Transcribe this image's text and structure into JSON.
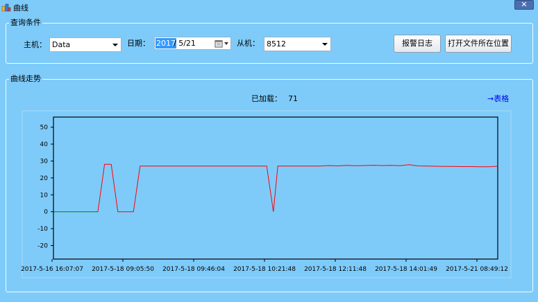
{
  "window": {
    "title": "曲线",
    "close_label": "✕"
  },
  "query": {
    "group_title": "查询条件",
    "host_label": "主机：",
    "host_value": "Data",
    "date_label": "日期：",
    "date_year": "2017",
    "date_rest": "/  5/21",
    "slave_label": "从机：",
    "slave_value": "8512",
    "alarm_log_button": "报警日志",
    "open_folder_button": "打开文件所在位置"
  },
  "trend": {
    "group_title": "曲线走势",
    "loaded_label": "已加载：",
    "loaded_count": "71",
    "table_link": "→表格"
  },
  "icons": {
    "app": "chart-window-icon",
    "calendar": "calendar-icon",
    "dropdown": "chevron-down-icon"
  },
  "chart_data": {
    "type": "line",
    "title": "",
    "xlabel": "",
    "ylabel": "",
    "ylim": [
      -28,
      56
    ],
    "yticks": [
      -20,
      -10,
      0,
      10,
      20,
      30,
      40,
      50
    ],
    "xtick_labels": [
      "2017-5-16 16:07:07",
      "2017-5-18 09:05:50",
      "2017-5-18 09:46:04",
      "2017-5-18 10:21:48",
      "2017-5-18 12:11:48",
      "2017-5-18 14:01:49",
      "2017-5-21 08:49:12"
    ],
    "grid": false,
    "legend": "none",
    "series": [
      {
        "color": "#008000",
        "x": [
          0,
          10
        ],
        "y": [
          0,
          0
        ]
      },
      {
        "color": "#ff0000",
        "x": [
          10,
          11.5,
          13,
          14.5,
          16,
          18,
          19.5,
          30,
          48,
          49.5,
          50.5,
          52,
          60,
          62,
          64,
          66,
          68,
          70,
          72,
          74,
          76,
          78,
          80,
          82,
          84,
          86,
          88,
          90,
          92,
          94,
          96,
          98,
          100
        ],
        "y": [
          0,
          28,
          28,
          0,
          0,
          0,
          27,
          27,
          27,
          0,
          27,
          27,
          27,
          27.3,
          27.1,
          27.4,
          27.2,
          27.3,
          27.5,
          27.3,
          27.4,
          27.2,
          27.8,
          27.1,
          27.0,
          26.9,
          26.8,
          26.8,
          26.7,
          26.7,
          26.6,
          26.6,
          26.9
        ]
      }
    ],
    "colors": {
      "frame": "#000000",
      "plot_bg": "#7ecbfa"
    }
  }
}
